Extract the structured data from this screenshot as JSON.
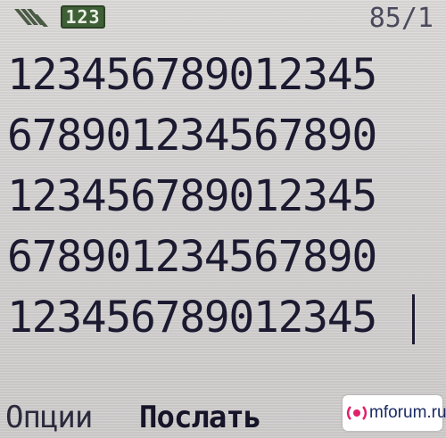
{
  "status_bar": {
    "signal_icon": "signal-strength-icon",
    "input_mode": "123",
    "char_counter": "85/1",
    "accent_color": "#3f5f36"
  },
  "message": {
    "lines": [
      "123456789012345",
      "678901234567890",
      "123456789012345",
      "678901234567890",
      "123456789012345"
    ]
  },
  "softkeys": {
    "left": "Опции",
    "center": "Послать",
    "right": ""
  },
  "watermark": {
    "text": "mforum.ru",
    "logo_icon": "mforum-logo-icon",
    "logo_color": "#e0206a"
  }
}
